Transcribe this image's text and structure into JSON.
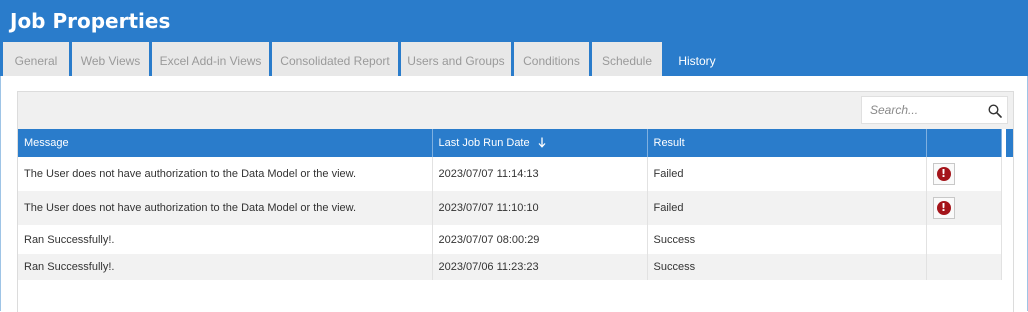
{
  "window": {
    "title": "Job Properties"
  },
  "tabs": [
    {
      "label": "General"
    },
    {
      "label": "Web Views"
    },
    {
      "label": "Excel Add-in Views"
    },
    {
      "label": "Consolidated Report"
    },
    {
      "label": "Users and Groups"
    },
    {
      "label": "Conditions"
    },
    {
      "label": "Schedule"
    },
    {
      "label": "History"
    }
  ],
  "active_tab": "History",
  "search": {
    "placeholder": "Search...",
    "value": "",
    "icon": "search-icon"
  },
  "table": {
    "columns": [
      {
        "label": "Message"
      },
      {
        "label": "Last Job Run Date",
        "sort": "descending",
        "sort_icon": "arrow-down-icon"
      },
      {
        "label": "Result"
      },
      {
        "label": ""
      }
    ],
    "rows": [
      {
        "message": "The User does not have authorization to the Data Model or the view.",
        "date": "2023/07/07 11:14:13",
        "result": "Failed",
        "action_icon": "error-icon"
      },
      {
        "message": "The User does not have authorization to the Data Model or the view.",
        "date": "2023/07/07 11:10:10",
        "result": "Failed",
        "action_icon": "error-icon"
      },
      {
        "message": "Ran Successfully!.",
        "date": "2023/07/07 08:00:29",
        "result": "Success"
      },
      {
        "message": "Ran Successfully!.",
        "date": "2023/07/06 11:23:23",
        "result": "Success"
      }
    ]
  },
  "colors": {
    "accent": "#2a7ccb",
    "error": "#a4141a",
    "tab_inactive_bg": "#e8e8e8"
  }
}
